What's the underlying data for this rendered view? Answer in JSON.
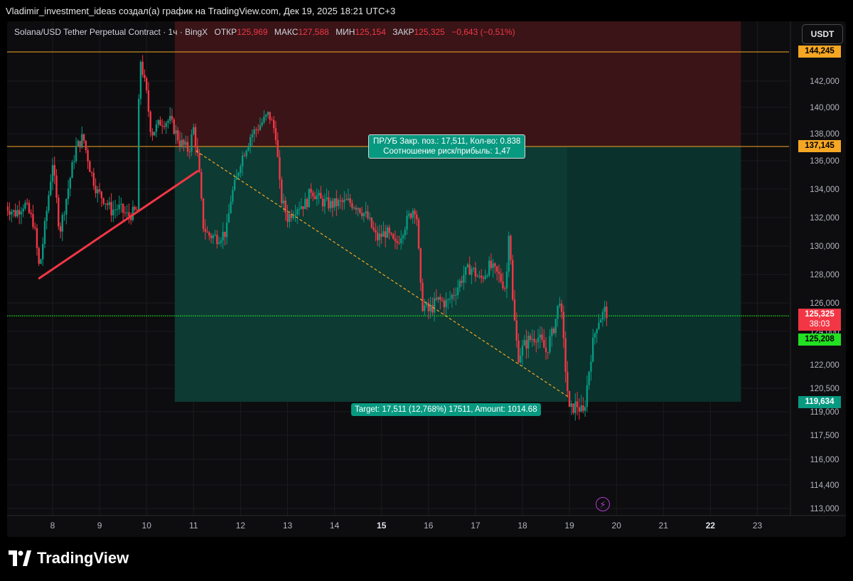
{
  "header": {
    "author_line": "Vladimir_investment_ideas создал(а) график на TradingView.com, Дек 19, 2025 18:21 UTC+3"
  },
  "legend": {
    "symbol": "Solana/USD Tether Perpetual Contract · 1ч · BingX",
    "open_label": "ОТКР",
    "open_value": "125,969",
    "high_label": "МАКС",
    "high_value": "127,588",
    "low_label": "МИН",
    "low_value": "125,154",
    "close_label": "ЗАКР",
    "close_value": "125,325",
    "change": "−0,643 (−0,51%)"
  },
  "currency": "USDT",
  "position": {
    "top_box_line1": "ПР/УБ Закр. поз.: 17,511, Кол-во: 0.838",
    "top_box_line2": "Соотношение риск/прибыль: 1,47",
    "target_box": "Target: 17,511 (12,768%) 17511, Amount: 1014.68",
    "stop_price": 144.245,
    "entry_price": 137.145,
    "target_price": 119.634
  },
  "price_tags": {
    "stop": "144,245",
    "entry": "137,145",
    "last": "125,325",
    "countdown": "38:03",
    "green_level": "125,208",
    "target": "119,634"
  },
  "colors": {
    "up": "#089981",
    "down": "#f23645",
    "stop_zone": "#3a1417",
    "target_zone": "#0d3a33",
    "orange_line": "#f5a623",
    "green_line": "#22e022",
    "trendline": "#f23645"
  },
  "icons": {
    "alert": "lightning-icon",
    "logo": "tradingview-logo-icon"
  },
  "logo_text": "TradingView",
  "chart_data": {
    "type": "candlestick",
    "symbol": "Solana/USD Tether Perpetual Contract",
    "timeframe": "1ч",
    "y_tick_labels": [
      "113,000",
      "114,400",
      "116,000",
      "117,500",
      "119,000",
      "120,500",
      "122,000",
      "124,000",
      "126,000",
      "128,000",
      "130,000",
      "132,000",
      "134,000",
      "136,000",
      "138,000",
      "140,000",
      "142,000"
    ],
    "x_tick_labels": [
      "8",
      "9",
      "10",
      "11",
      "12",
      "13",
      "14",
      "15",
      "16",
      "17",
      "18",
      "19",
      "20",
      "21",
      "22",
      "23"
    ],
    "x_tick_days": [
      8,
      9,
      10,
      11,
      12,
      13,
      14,
      15,
      16,
      17,
      18,
      19,
      20,
      21,
      22,
      23
    ],
    "x_tick_bold_days": [
      15,
      22
    ],
    "ylim": [
      112.5,
      146.8
    ],
    "xlim": [
      7.05,
      24.1
    ],
    "close_path_points": [
      [
        7.0,
        132.8
      ],
      [
        7.2,
        132.3
      ],
      [
        7.4,
        133.0
      ],
      [
        7.6,
        131.6
      ],
      [
        7.72,
        128.3
      ],
      [
        7.85,
        131.8
      ],
      [
        8.0,
        135.9
      ],
      [
        8.15,
        131.0
      ],
      [
        8.3,
        133.5
      ],
      [
        8.5,
        137.0
      ],
      [
        8.65,
        137.8
      ],
      [
        8.8,
        135.4
      ],
      [
        8.95,
        133.8
      ],
      [
        9.1,
        133.3
      ],
      [
        9.25,
        132.5
      ],
      [
        9.4,
        132.7
      ],
      [
        9.6,
        132.1
      ],
      [
        9.8,
        132.5
      ],
      [
        9.85,
        144.1
      ],
      [
        10.0,
        141.0
      ],
      [
        10.1,
        138.0
      ],
      [
        10.3,
        138.9
      ],
      [
        10.5,
        139.0
      ],
      [
        10.7,
        137.5
      ],
      [
        10.9,
        136.8
      ],
      [
        11.0,
        138.4
      ],
      [
        11.1,
        136.0
      ],
      [
        11.2,
        131.5
      ],
      [
        11.3,
        130.8
      ],
      [
        11.5,
        130.6
      ],
      [
        11.7,
        131.0
      ],
      [
        11.8,
        133.5
      ],
      [
        11.9,
        134.5
      ],
      [
        12.0,
        136.0
      ],
      [
        12.2,
        137.8
      ],
      [
        12.4,
        138.6
      ],
      [
        12.6,
        139.5
      ],
      [
        12.75,
        138.0
      ],
      [
        12.85,
        133.5
      ],
      [
        13.0,
        132.0
      ],
      [
        13.2,
        132.8
      ],
      [
        13.4,
        133.0
      ],
      [
        13.5,
        134.0
      ],
      [
        13.7,
        133.2
      ],
      [
        13.9,
        132.9
      ],
      [
        14.1,
        133.0
      ],
      [
        14.3,
        133.1
      ],
      [
        14.5,
        132.8
      ],
      [
        14.7,
        132.0
      ],
      [
        14.9,
        130.5
      ],
      [
        15.1,
        131.0
      ],
      [
        15.3,
        130.0
      ],
      [
        15.5,
        131.5
      ],
      [
        15.7,
        132.8
      ],
      [
        15.75,
        132.0
      ],
      [
        15.85,
        126.0
      ],
      [
        16.0,
        125.5
      ],
      [
        16.2,
        126.2
      ],
      [
        16.4,
        126.0
      ],
      [
        16.6,
        127.0
      ],
      [
        16.75,
        128.0
      ],
      [
        16.9,
        128.5
      ],
      [
        17.1,
        127.6
      ],
      [
        17.3,
        128.6
      ],
      [
        17.5,
        127.9
      ],
      [
        17.65,
        127.0
      ],
      [
        17.72,
        132.0
      ],
      [
        17.78,
        126.5
      ],
      [
        17.9,
        122.5
      ],
      [
        18.1,
        123.4
      ],
      [
        18.3,
        123.8
      ],
      [
        18.5,
        122.8
      ],
      [
        18.65,
        124.0
      ],
      [
        18.8,
        126.5
      ],
      [
        18.88,
        123.0
      ],
      [
        19.0,
        119.0
      ],
      [
        19.15,
        119.5
      ],
      [
        19.3,
        118.8
      ],
      [
        19.45,
        122.5
      ],
      [
        19.6,
        124.8
      ],
      [
        19.75,
        125.5
      ],
      [
        19.82,
        125.3
      ]
    ],
    "trendline": {
      "from": [
        7.7,
        127.7
      ],
      "to": [
        11.1,
        135.3
      ]
    },
    "dashed_path": {
      "from": [
        11.05,
        136.8
      ],
      "to": [
        19.0,
        119.9
      ]
    },
    "stop_zone": {
      "x0": 10.6,
      "x1": 22.65,
      "y0": 137.145,
      "y1": 146.8
    },
    "target_zone": {
      "x0": 10.6,
      "x1": 22.65,
      "y0": 119.634,
      "y1": 137.145
    },
    "target_zone_right_fade": 18.95,
    "horizontal_lines": [
      {
        "price": 144.245,
        "color": "orange"
      },
      {
        "price": 137.145,
        "color": "orange"
      },
      {
        "price": 125.208,
        "color": "green"
      }
    ],
    "last_price": 125.325
  }
}
